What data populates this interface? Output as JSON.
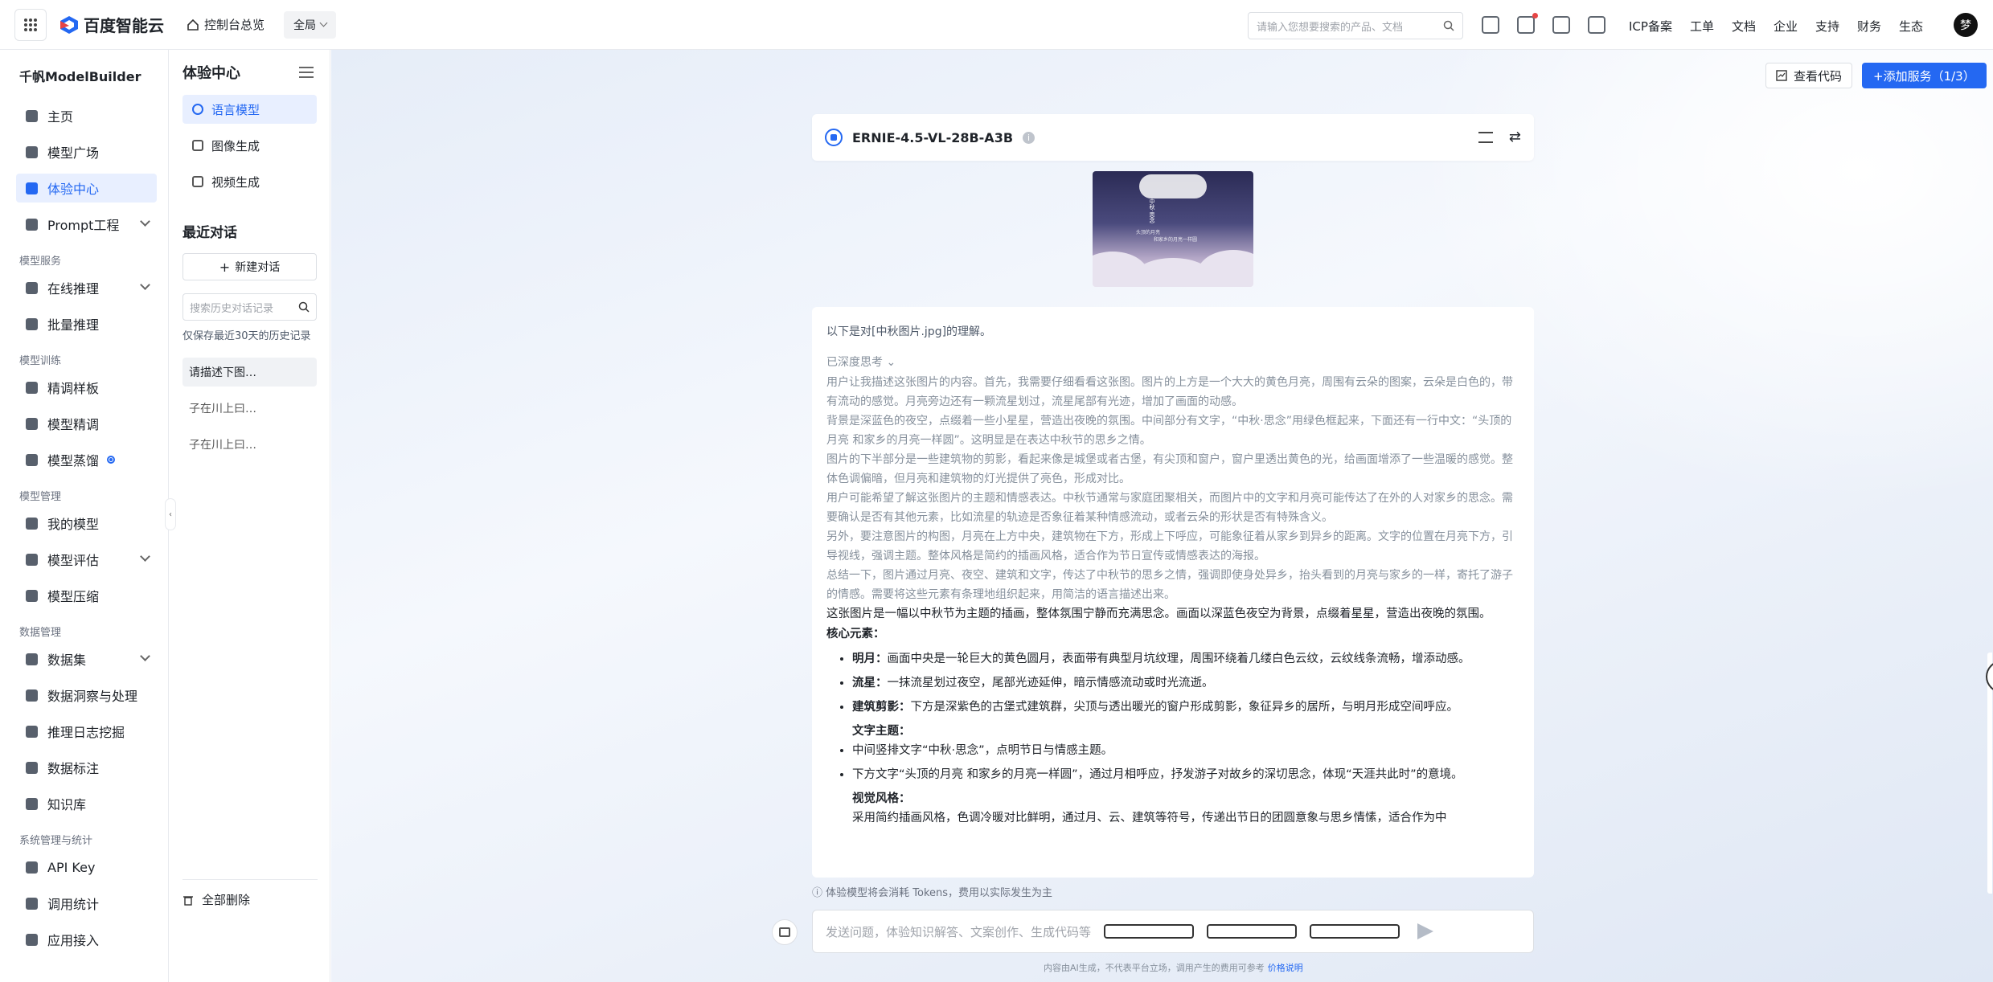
{
  "topbar": {
    "logo": "百度智能云",
    "home": "控制台总览",
    "region": "全局",
    "search_placeholder": "请输入您想要搜索的产品、文档",
    "links": [
      "ICP备案",
      "工单",
      "文档",
      "企业",
      "支持",
      "财务",
      "生态"
    ],
    "avatar": "梦"
  },
  "sidebar": {
    "title": "千帆ModelBuilder",
    "items": [
      {
        "label": "主页"
      },
      {
        "label": "模型广场"
      },
      {
        "label": "体验中心",
        "active": true
      },
      {
        "label": "Prompt工程",
        "chevron": true
      }
    ],
    "sections": [
      {
        "title": "模型服务",
        "items": [
          {
            "label": "在线推理",
            "chevron": true
          },
          {
            "label": "批量推理"
          }
        ]
      },
      {
        "title": "模型训练",
        "items": [
          {
            "label": "精调样板"
          },
          {
            "label": "模型精调"
          },
          {
            "label": "模型蒸馏",
            "badge": true
          }
        ]
      },
      {
        "title": "模型管理",
        "items": [
          {
            "label": "我的模型"
          },
          {
            "label": "模型评估",
            "chevron": true
          },
          {
            "label": "模型压缩"
          }
        ]
      },
      {
        "title": "数据管理",
        "items": [
          {
            "label": "数据集",
            "chevron": true
          },
          {
            "label": "数据洞察与处理"
          },
          {
            "label": "推理日志挖掘"
          },
          {
            "label": "数据标注"
          },
          {
            "label": "知识库"
          }
        ]
      },
      {
        "title": "系统管理与统计",
        "items": [
          {
            "label": "API Key"
          },
          {
            "label": "调用统计"
          },
          {
            "label": "应用接入"
          }
        ]
      }
    ]
  },
  "panel": {
    "title": "体验中心",
    "items": [
      {
        "label": "语言模型",
        "active": true
      },
      {
        "label": "图像生成"
      },
      {
        "label": "视频生成"
      }
    ],
    "recent_title": "最近对话",
    "new_chat": "新建对话",
    "history_search_placeholder": "搜索历史对话记录",
    "history_note": "仅保存最近30天的历史记录",
    "history": [
      "请描述下图…",
      "子在川上曰…",
      "子在川上曰…"
    ],
    "delete_all": "全部删除"
  },
  "main": {
    "view_code": "查看代码",
    "add_service": "+添加服务（1/3）",
    "model_name": "ERNIE-4.5-VL-28B-A3B",
    "thumb_text": [
      "中",
      "秋",
      "·",
      "思",
      "念",
      "头顶的月亮",
      "和家乡的月亮一样圆"
    ],
    "answer": {
      "intro": "以下是对[中秋图片.jpg]的理解。",
      "think_toggle": "已深度思考",
      "thinking": [
        "用户让我描述这张图片的内容。首先，我需要仔细看看这张图。图片的上方是一个大大的黄色月亮，周围有云朵的图案，云朵是白色的，带有流动的感觉。月亮旁边还有一颗流星划过，流星尾部有光迹，增加了画面的动感。",
        "背景是深蓝色的夜空，点缀着一些小星星，营造出夜晚的氛围。中间部分有文字，“中秋·思念”用绿色框起来，下面还有一行中文：“头顶的月亮 和家乡的月亮一样圆”。这明显是在表达中秋节的思乡之情。",
        "图片的下半部分是一些建筑物的剪影，看起来像是城堡或者古堡，有尖顶和窗户，窗户里透出黄色的光，给画面增添了一些温暖的感觉。整体色调偏暗，但月亮和建筑物的灯光提供了亮色，形成对比。",
        "用户可能希望了解这张图片的主题和情感表达。中秋节通常与家庭团聚相关，而图片中的文字和月亮可能传达了在外的人对家乡的思念。需要确认是否有其他元素，比如流星的轨迹是否象征着某种情感流动，或者云朵的形状是否有特殊含义。",
        "另外，要注意图片的构图，月亮在上方中央，建筑物在下方，形成上下呼应，可能象征着从家乡到异乡的距离。文字的位置在月亮下方，引导视线，强调主题。整体风格是简约的插画风格，适合作为节日宣传或情感表达的海报。",
        "总结一下，图片通过月亮、夜空、建筑和文字，传达了中秋节的思乡之情，强调即使身处异乡，抬头看到的月亮与家乡的一样，寄托了游子的情感。需要将这些元素有条理地组织起来，用简洁的语言描述出来。"
      ],
      "summary": "这张图片是一幅以中秋节为主题的插画，整体氛围宁静而充满思念。画面以深蓝色夜空为背景，点缀着星星，营造出夜晚的氛围。",
      "core_title": "核心元素：",
      "core": [
        {
          "term": "明月：",
          "text": "画面中央是一轮巨大的黄色圆月，表面带有典型月坑纹理，周围环绕着几缕白色云纹，云纹线条流畅，增添动感。"
        },
        {
          "term": "流星：",
          "text": "一抹流星划过夜空，尾部光迹延伸，暗示情感流动或时光流逝。"
        },
        {
          "term": "建筑剪影：",
          "text": "下方是深紫色的古堡式建筑群，尖顶与透出暖光的窗户形成剪影，象征异乡的居所，与明月形成空间呼应。"
        }
      ],
      "text_title": "文字主题：",
      "text_items": [
        "中间竖排文字“中秋·思念”，点明节日与情感主题。",
        "下方文字“头顶的月亮 和家乡的月亮一样圆”，通过月相呼应，抒发游子对故乡的深切思念，体现“天涯共此时”的意境。"
      ],
      "visual_title": "视觉风格：",
      "visual_text": "采用简约插画风格，色调冷暖对比鲜明，通过月、云、建筑等符号，传递出节日的团圆意象与思乡情愫，适合作为中"
    },
    "notice": "体验模型将会消耗 Tokens，费用以实际发生为主",
    "input_placeholder": "发送问题，体验知识解答、文案创作、生成代码等",
    "disclaimer": "内容由AI生成，不代表平台立场，调用产生的费用可参考",
    "disclaimer_link": "价格说明"
  }
}
